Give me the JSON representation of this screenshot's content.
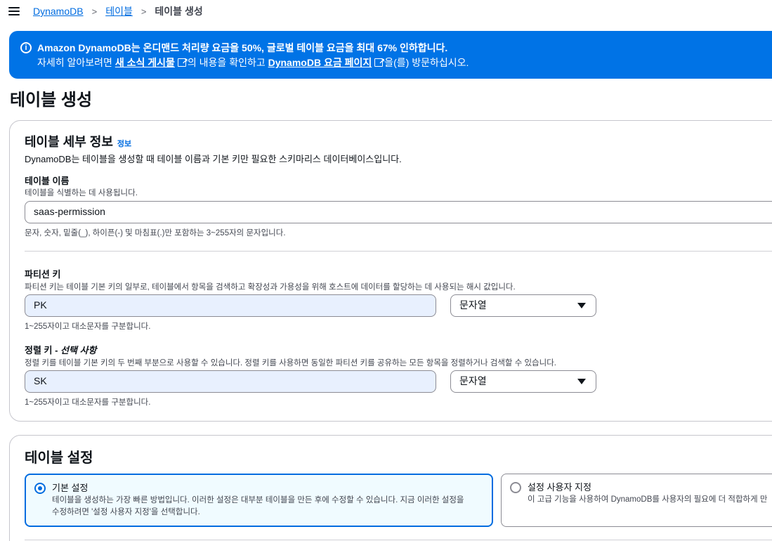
{
  "breadcrumb": {
    "items": [
      "DynamoDB",
      "테이블"
    ],
    "current": "테이블 생성"
  },
  "flash": {
    "title": "Amazon DynamoDB는 온디맨드 처리량 요금을 50%, 글로벌 테이블 요금을 최대 67% 인하합니다.",
    "text_before": "자세히 알아보려면 ",
    "link1": "새 소식 게시물",
    "text_middle": "의 내용을 확인하고 ",
    "link2": "DynamoDB 요금 페이지",
    "text_after": "을(를) 방문하십시오."
  },
  "page_title": "테이블 생성",
  "details": {
    "title": "테이블 세부 정보",
    "info": "정보",
    "description": "DynamoDB는 테이블을 생성할 때 테이블 이름과 기본 키만 필요한 스키마리스 데이터베이스입니다.",
    "table_name": {
      "label": "테이블 이름",
      "sub": "테이블을 식별하는 데 사용됩니다.",
      "value": "saas-permission",
      "hint": "문자, 숫자, 밑줄(_), 하이픈(-) 및 마침표(.)만 포함하는 3~255자의 문자입니다."
    },
    "partition_key": {
      "label": "파티션 키",
      "sub": "파티션 키는 테이블 기본 키의 일부로, 테이블에서 항목을 검색하고 확장성과 가용성을 위해 호스트에 데이터를 할당하는 데 사용되는 해시 값입니다.",
      "value": "PK",
      "type": "문자열",
      "hint": "1~255자이고 대소문자를 구분합니다."
    },
    "sort_key": {
      "label": "정렬 키 - ",
      "label_optional": "선택 사항",
      "sub": "정렬 키를 테이블 기본 키의 두 번째 부분으로 사용할 수 있습니다. 정렬 키를 사용하면 동일한 파티션 키를 공유하는 모든 항목을 정렬하거나 검색할 수 있습니다.",
      "value": "SK",
      "type": "문자열",
      "hint": "1~255자이고 대소문자를 구분합니다."
    }
  },
  "settings": {
    "title": "테이블 설정",
    "options": [
      {
        "title": "기본 설정",
        "desc_line1": "테이블을 생성하는 가장 빠른 방법입니다. 이러한 설정은 대부분 테이블을 만든 후에 수정할 수 있습니다. 지금 이러한 설정을",
        "desc_line2": "수정하려면 '설정 사용자 지정'을 선택합니다.",
        "selected": true
      },
      {
        "title": "설정 사용자 지정",
        "desc_line1": "이 고급 기능을 사용하여 DynamoDB를 사용자의 필요에 더 적합하게 만",
        "desc_line2": "",
        "selected": false
      }
    ]
  },
  "colors": {
    "accent": "#006ce0",
    "flash_bg": "#0073e6",
    "filled_input_bg": "#e8f0fe"
  }
}
